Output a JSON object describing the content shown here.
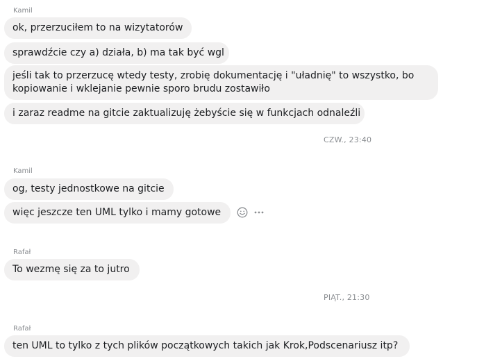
{
  "conversation": {
    "groups": [
      {
        "sender": "Kamil",
        "messages": [
          "ok, przerzuciłem to na wizytatorów",
          "sprawdźcie czy a) działa, b) ma tak być wgl",
          "jeśli tak to przerzucę wtedy testy, zrobię dokumentację i \"uładnię\" to wszystko, bo kopiowanie i wklejanie pewnie sporo brudu zostawiło",
          "i zaraz readme na gitcie zaktualizuję żebyście się w funkcjach odnaleźli"
        ]
      },
      {
        "timestamp": "CZW., 23:40"
      },
      {
        "sender": "Kamil",
        "messages": [
          "og, testy jednostkowe na gitcie",
          "więc jeszcze ten UML tylko i mamy gotowe"
        ]
      },
      {
        "sender": "Rafał",
        "messages": [
          "To wezmę się za to jutro"
        ]
      },
      {
        "timestamp": "PIĄT., 21:30"
      },
      {
        "sender": "Rafał",
        "messages": [
          "ten UML to tylko z tych plików początkowych takich jak Krok,Podscenariusz itp?"
        ]
      }
    ],
    "actions": {
      "react_icon": "emoji-icon",
      "more_icon": "more-options-icon"
    }
  }
}
